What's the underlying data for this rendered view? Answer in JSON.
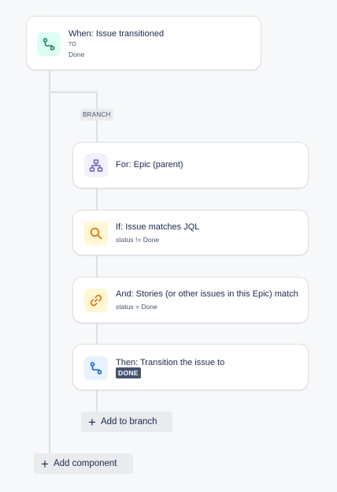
{
  "trigger": {
    "title": "When: Issue transitioned",
    "to_label": "TO",
    "to_value": "Done",
    "icon": "route-icon",
    "icon_color": "#1f845a",
    "icon_bg": "#dcfff1"
  },
  "branch": {
    "tag": "BRANCH",
    "for_card": {
      "title": "For: Epic (parent)",
      "icon": "hierarchy-icon",
      "icon_color": "#6e5dc6",
      "icon_bg": "#f3f0ff"
    },
    "if_card": {
      "title": "If: Issue matches JQL",
      "subtitle": "status != Done",
      "icon": "search-icon",
      "icon_color": "#e2740f",
      "icon_bg": "#fff7d6"
    },
    "and_card": {
      "title": "And: Stories (or other issues in this Epic) match",
      "subtitle": "status = Done",
      "icon": "link-icon",
      "icon_color": "#e2740f",
      "icon_bg": "#fff7d6"
    },
    "then_card": {
      "title": "Then: Transition the issue to",
      "status": "DONE",
      "icon": "route-icon",
      "icon_color": "#0c66e4",
      "icon_bg": "#e9f2ff"
    },
    "add_button": "Add to branch"
  },
  "add_component_button": "Add component"
}
